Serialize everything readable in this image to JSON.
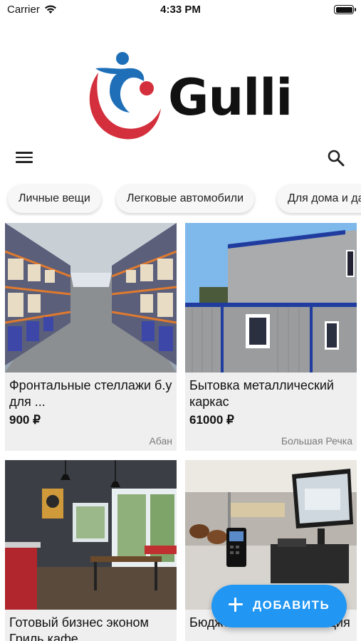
{
  "status_bar": {
    "carrier": "Carrier",
    "time": "4:33 PM"
  },
  "header": {
    "brand": "Gulli"
  },
  "categories": [
    "Личные вещи",
    "Легковые автомобили",
    "Для дома и дачи"
  ],
  "listings": [
    {
      "title": "Фронтальные стеллажи б.у для ...",
      "price": "900 ₽",
      "city": "Абан"
    },
    {
      "title": "Бытовка металлический каркас",
      "price": "61000 ₽",
      "city": "Большая Речка"
    },
    {
      "title": "Готовый бизнес эконом Гриль кафе",
      "price": "",
      "city": ""
    },
    {
      "title": "Бюджетная автоматизация",
      "price": "",
      "city": ""
    }
  ],
  "fab": {
    "label": "ДОБАВИТЬ"
  },
  "colors": {
    "accent": "#2196f3",
    "logo_red": "#d32f3c",
    "logo_blue": "#1e6fb8"
  }
}
